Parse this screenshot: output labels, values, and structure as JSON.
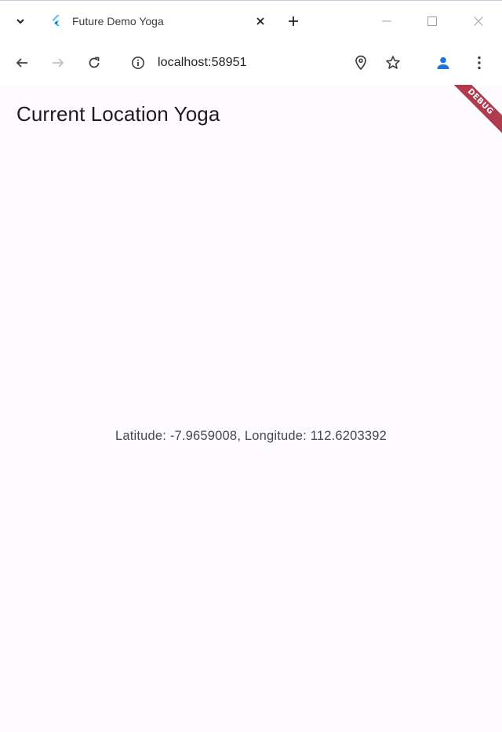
{
  "browser": {
    "tab": {
      "title": "Future Demo Yoga",
      "favicon": "flutter-icon"
    },
    "url": "localhost:58951",
    "icons": {
      "tab_search": "chevron-down-icon",
      "tab_close": "close-icon",
      "new_tab": "plus-icon",
      "minimize": "minimize-icon",
      "maximize": "maximize-icon",
      "window_close": "close-icon",
      "back": "arrow-left-icon",
      "forward": "arrow-right-icon",
      "reload": "reload-icon",
      "site_info": "info-icon",
      "location": "location-pin-icon",
      "bookmark": "star-icon",
      "profile": "person-icon",
      "menu": "kebab-menu-icon"
    },
    "colors": {
      "profile_accent": "#1a73e8"
    }
  },
  "app": {
    "title": "Current Location Yoga",
    "location_text": "Latitude: -7.9659008, Longitude: 112.6203392",
    "debug_banner": "DEBUG",
    "colors": {
      "background": "#fdfbff",
      "debug_banner": "#b13b4d"
    }
  }
}
